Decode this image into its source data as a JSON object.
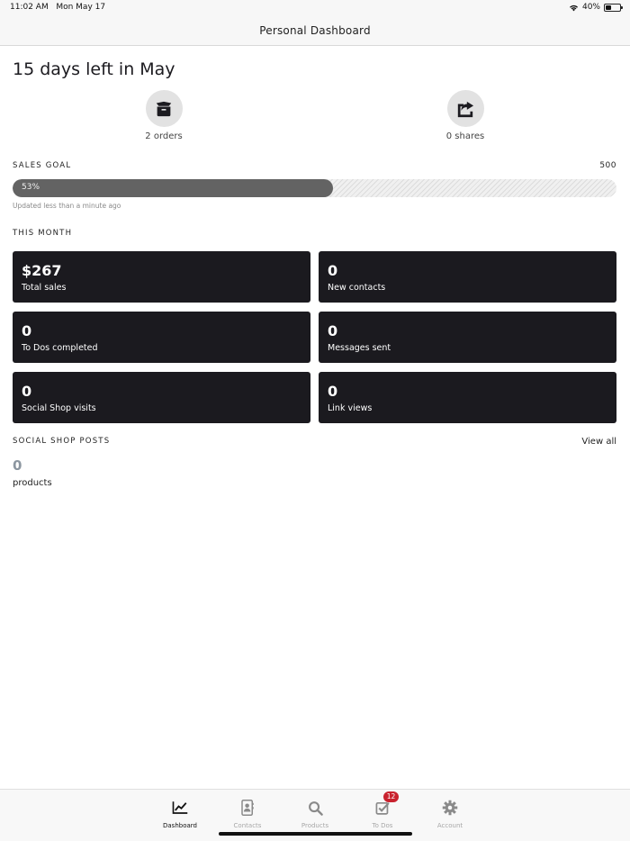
{
  "status_bar": {
    "time": "11:02 AM",
    "date": "Mon May 17",
    "battery": "40%",
    "battery_level": 0.4,
    "icons": [
      "wifi-icon",
      "battery-icon"
    ]
  },
  "header": {
    "title": "Personal Dashboard"
  },
  "dashboard": {
    "days_left": "15 days left in May",
    "orders": {
      "label": "2 orders",
      "icon": "box-icon"
    },
    "shares": {
      "label": "0 shares",
      "icon": "share-icon"
    }
  },
  "sales_goal": {
    "title": "SALES GOAL",
    "goal": "500",
    "percent_label": "53%",
    "progress": 0.53,
    "updated": "Updated less than a minute ago"
  },
  "this_month": {
    "title": "THIS MONTH",
    "cards": [
      {
        "value": "$267",
        "label": "Total sales"
      },
      {
        "value": "0",
        "label": "New contacts"
      },
      {
        "value": "0",
        "label": "To Dos completed"
      },
      {
        "value": "0",
        "label": "Messages sent"
      },
      {
        "value": "0",
        "label": "Social Shop visits"
      },
      {
        "value": "0",
        "label": "Link views"
      }
    ]
  },
  "social_shop": {
    "title": "SOCIAL SHOP POSTS",
    "view_all": "View all",
    "count": "0",
    "count_label": "products"
  },
  "tab_bar": {
    "tabs": [
      {
        "label": "Dashboard",
        "icon": "chart-icon",
        "active": true
      },
      {
        "label": "Contacts",
        "icon": "contacts-icon"
      },
      {
        "label": "Products",
        "icon": "search-icon"
      },
      {
        "label": "To Dos",
        "icon": "checkbox-icon",
        "badge": "12"
      },
      {
        "label": "Account",
        "icon": "gear-icon"
      }
    ]
  },
  "colors": {
    "card_bg": "#1b1a1f",
    "progress_fill": "#636363",
    "badge": "#c9222e",
    "muted": "#8c96a0"
  }
}
